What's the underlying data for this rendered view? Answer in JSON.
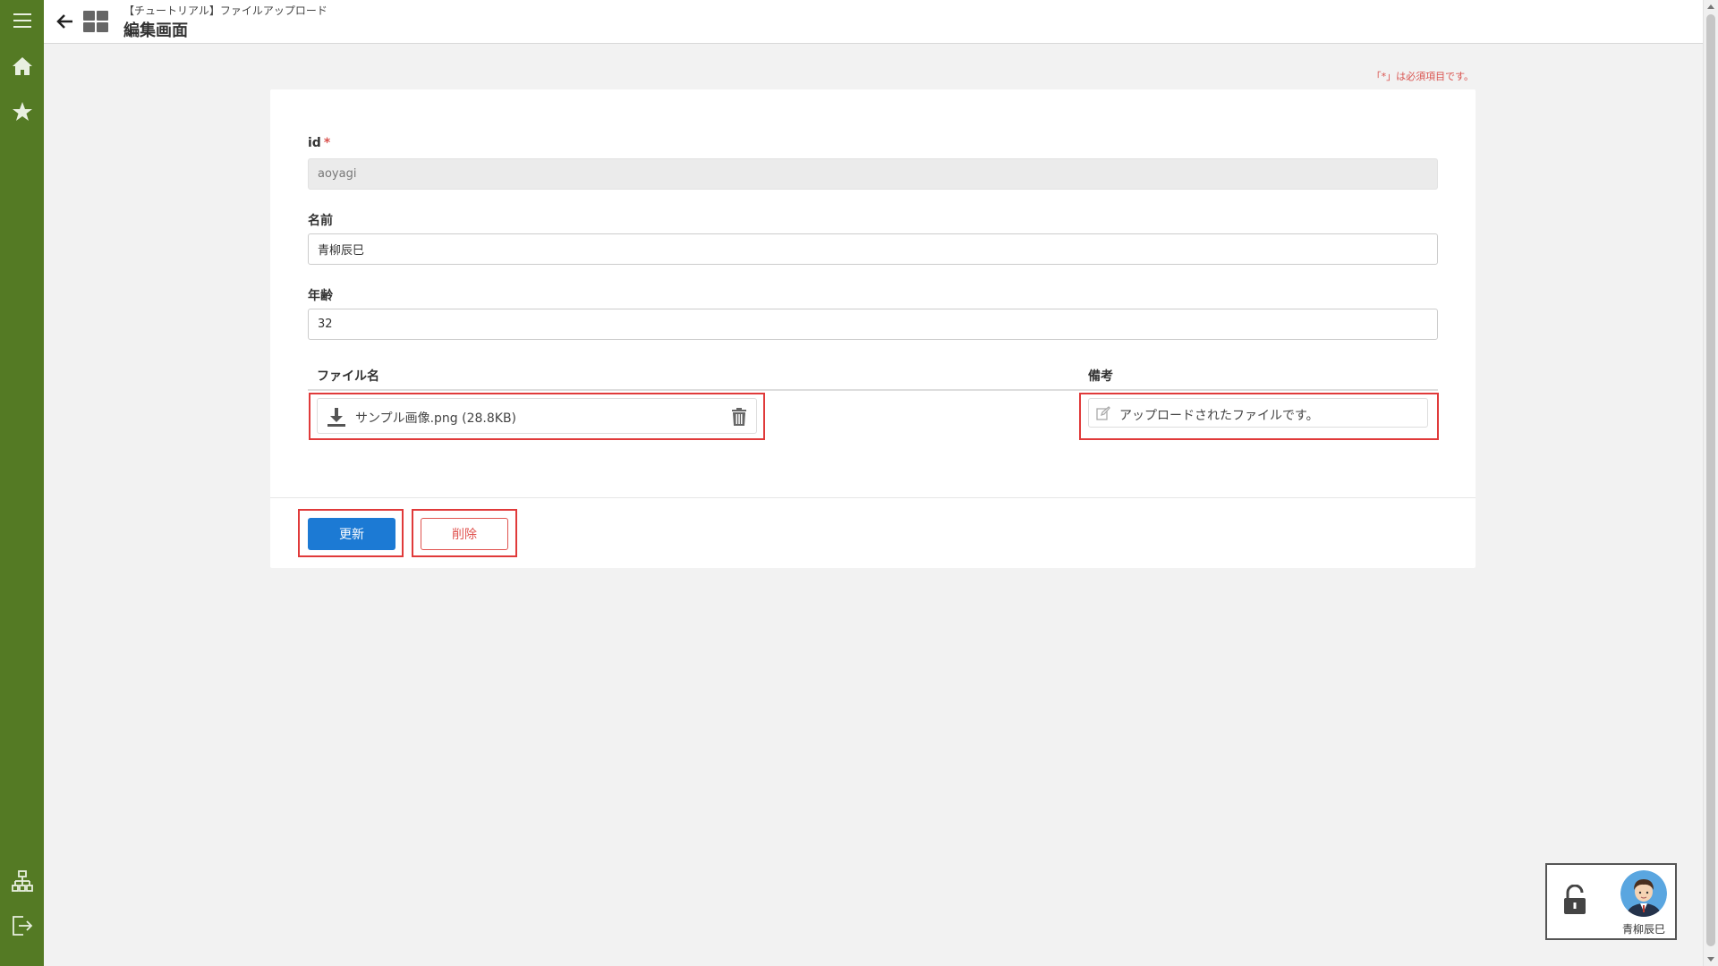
{
  "header": {
    "breadcrumb": "【チュートリアル】ファイルアップロード",
    "title": "編集画面"
  },
  "required_note": "「*」は必須項目です。",
  "form": {
    "id": {
      "label": "id",
      "required_mark": "*",
      "value": "aoyagi"
    },
    "name": {
      "label": "名前",
      "value": "青柳辰巳"
    },
    "age": {
      "label": "年齢",
      "value": "32"
    }
  },
  "files_table": {
    "columns": [
      "ファイル名",
      "備考"
    ],
    "rows": [
      {
        "file": "サンプル画像.png (28.8KB)",
        "note": "アップロードされたファイルです。"
      }
    ]
  },
  "buttons": {
    "update": "更新",
    "delete": "削除"
  },
  "user": {
    "name": "青柳辰巳"
  },
  "colors": {
    "sidebar": "#547a24",
    "primary_button": "#1c7ad4",
    "danger": "#e0534f",
    "highlight": "#e03a3a"
  },
  "icons": [
    "menu-icon",
    "home-icon",
    "star-icon",
    "sitemap-icon",
    "logout-icon",
    "back-arrow-icon",
    "apps-grid-icon",
    "download-icon",
    "trash-icon",
    "edit-icon",
    "lock-icon"
  ]
}
